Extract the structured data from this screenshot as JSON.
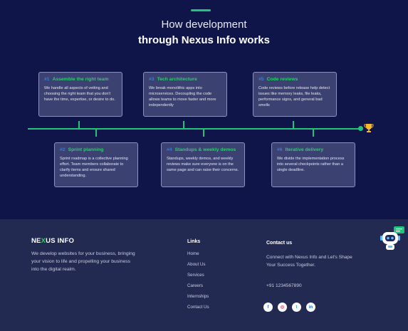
{
  "hero": {
    "title_line1": "How development",
    "title_line2": "through Nexus Info works"
  },
  "steps": [
    {
      "num": "#1",
      "title": "Assemble the right team",
      "body": "We handle all aspects of vetting and choosing the right team that you don't have the time, expertise, or desire to do."
    },
    {
      "num": "#2",
      "title": "Sprint planning",
      "body": "Sprint roadmap is a collective planning effort. Team members collaborate to clarify items and ensure shared understanding."
    },
    {
      "num": "#3",
      "title": "Tech architecture",
      "body": "We break monolithic apps into microservices. Decoupling the code allows teams to move faster and more independently"
    },
    {
      "num": "#4",
      "title": "Standups & weekly demos",
      "body": "Standups, weekly demos, and weekly reviews make sure everyone is on the same page and can raise their concerns."
    },
    {
      "num": "#5",
      "title": "Code reviews",
      "body": "Code reviews before release help detect issues like memory leaks, file leaks, performance signs, and general bad smells"
    },
    {
      "num": "#6",
      "title": "Iterative delivery",
      "body": "We divide the implementation process into several checkpoints rather than a single deadline."
    }
  ],
  "footer": {
    "logo_prefix": "NE",
    "logo_x": "X",
    "logo_suffix": "US INFO",
    "tagline": "We develop websites for your business, bringing your vision to life and propelling your business into the digital realm.",
    "links_title": "Links",
    "links": [
      "Home",
      "About Us",
      "Services",
      "Careers",
      "Internships",
      "Contact Us"
    ],
    "contact_title": "Contact us",
    "contact_text": "Connect with Nexus Info and Let's Shape Your Success Together.",
    "phone": "+91 1234567890",
    "social": [
      {
        "icon": "facebook-icon",
        "glyph": "f",
        "color": "#1877f2"
      },
      {
        "icon": "instagram-icon",
        "glyph": "◎",
        "color": "#e1306c"
      },
      {
        "icon": "twitter-icon",
        "glyph": "t",
        "color": "#1da1f2"
      },
      {
        "icon": "linkedin-icon",
        "glyph": "in",
        "color": "#0a66c2"
      }
    ]
  },
  "colors": {
    "accent_green": "#22c47a",
    "hero_bg": "#0f1548",
    "footer_bg": "#232a52",
    "card_bg": "#3b4271"
  }
}
